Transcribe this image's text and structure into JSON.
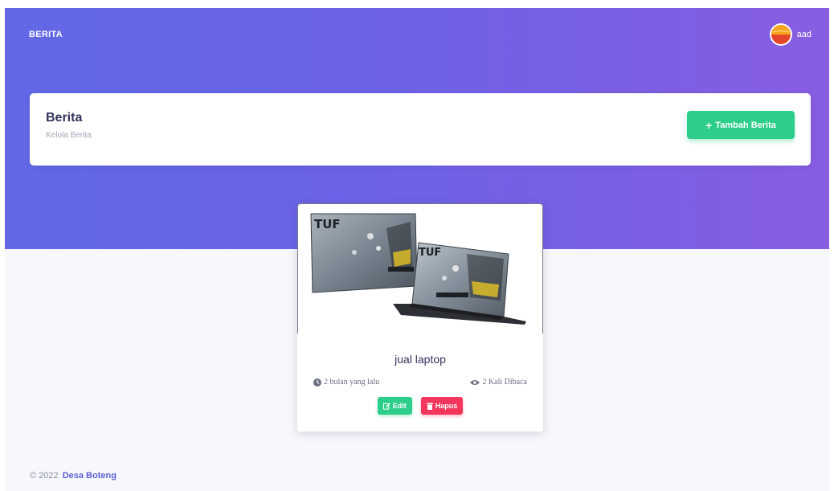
{
  "navbar": {
    "brand": "BERITA",
    "user_name": "aad",
    "avatar_icon": "avatar-icon"
  },
  "page_header": {
    "title": "Berita",
    "subtitle": "Kelola Berita",
    "add_button": {
      "icon": "plus-icon",
      "label": "Tambah Berita"
    }
  },
  "news_items": [
    {
      "title": "jual laptop",
      "time_ago": "2 bulan yang lalu",
      "views": "2 Kali Dibaca",
      "image_caption": "TUF",
      "edit_label": "Edit",
      "delete_label": "Hapus"
    }
  ],
  "footer": {
    "copyright": "© 2022",
    "org_name": "Desa Boteng"
  },
  "colors": {
    "hero_start": "#6268e6",
    "hero_end": "#875ee2",
    "success": "#2dce89",
    "danger": "#f5365c",
    "heading": "#32325d"
  }
}
